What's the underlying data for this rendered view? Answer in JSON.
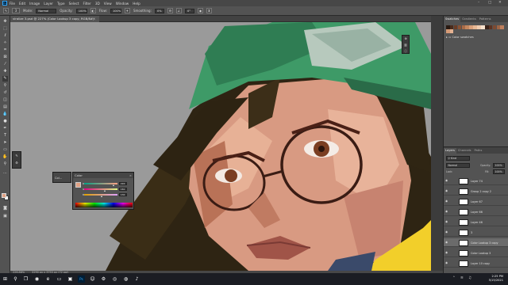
{
  "menubar": {
    "logo": "Ps",
    "items": [
      "File",
      "Edit",
      "Image",
      "Layer",
      "Type",
      "Select",
      "Filter",
      "3D",
      "View",
      "Window",
      "Help"
    ],
    "minimize": "–",
    "maximize": "□",
    "close": "✕"
  },
  "options": {
    "brush_size": "3",
    "mode_label": "Mode:",
    "mode_value": "Normal",
    "opacity_label": "Opacity:",
    "opacity_value": "100%",
    "flow_label": "Flow:",
    "flow_value": "100%",
    "smoothing_label": "Smoothing:",
    "smoothing_value": "0%",
    "angle_value": "0°"
  },
  "document": {
    "tab_title": "viralize 3.psd @ 227% (Color Lookup 3 copy, RGB/8#)",
    "tab_close": "×"
  },
  "status": {
    "zoom": "226.88%",
    "doc_size": "3290 px x 3753 px (72 ppi)"
  },
  "color_panel": {
    "collapsed_label": "Col...",
    "title": "Color",
    "close": "×",
    "r_label": "R",
    "g_label": "G",
    "b_label": "B",
    "r_value": "224",
    "g_value": "161",
    "b_value": "132",
    "r_frac": 0.88,
    "g_frac": 0.63,
    "b_frac": 0.52
  },
  "panels_top": {
    "tabs": [
      "Swatches",
      "Gradients",
      "Patterns"
    ],
    "folder": "Color swatches",
    "swatch_colors": [
      "#2a1a12",
      "#4a2c1c",
      "#6b3d26",
      "#8a5234",
      "#a86b48",
      "#c4875e",
      "#d9a07a",
      "#e7b894",
      "#f0cdb0",
      "#f7e1cc",
      "#3a2218",
      "#5c3322",
      "#7d4a32",
      "#9e6445",
      "#bd7f5d",
      "#d59a76",
      "#e5b291"
    ]
  },
  "layers_panel": {
    "tabs": [
      "Layers",
      "Channels",
      "Paths"
    ],
    "kind_label": "Kind",
    "blend_mode": "Normal",
    "opacity_label": "Opacity:",
    "opacity_value": "100%",
    "lock_label": "Lock:",
    "fill_label": "Fill:",
    "fill_value": "100%",
    "rows": [
      {
        "name": "Layer 74",
        "selected": false
      },
      {
        "name": "Group 2 copy 2",
        "selected": false
      },
      {
        "name": "Layer 67",
        "selected": false
      },
      {
        "name": "Layer 66",
        "selected": false
      },
      {
        "name": "Layer 46",
        "selected": false
      },
      {
        "name": "3",
        "selected": false
      },
      {
        "name": "Color Lookup 3 copy",
        "selected": true
      },
      {
        "name": "Color Lookup 3",
        "selected": false
      },
      {
        "name": "Layer 10 copy",
        "selected": false
      }
    ]
  },
  "taskbar": {
    "start_icon": "windows-start",
    "time": "2:25 PM",
    "date": "5/15/2021"
  }
}
